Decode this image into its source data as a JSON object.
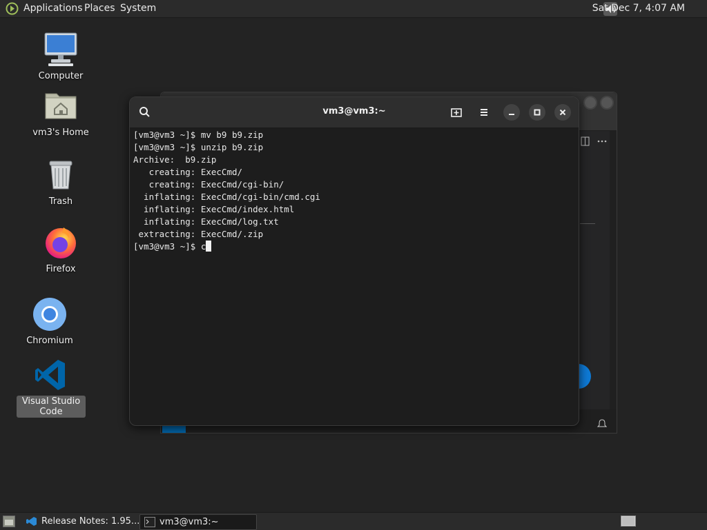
{
  "top_panel": {
    "menus": [
      "Applications",
      "Places",
      "System"
    ],
    "clock": "Sat Dec  7,  4:07 AM"
  },
  "desktop": {
    "icons": [
      {
        "label": "Computer"
      },
      {
        "label": "vm3's Home"
      },
      {
        "label": "Trash"
      },
      {
        "label": "Firefox"
      },
      {
        "label": "Chromium"
      },
      {
        "label": "Visual Studio Code",
        "selected": true
      }
    ]
  },
  "terminal": {
    "title": "vm3@vm3:~",
    "lines": [
      "[vm3@vm3 ~]$ mv b9 b9.zip",
      "[vm3@vm3 ~]$ unzip b9.zip",
      "Archive:  b9.zip",
      "   creating: ExecCmd/",
      "   creating: ExecCmd/cgi-bin/",
      "  inflating: ExecCmd/cgi-bin/cmd.cgi",
      "  inflating: ExecCmd/index.html",
      "  inflating: ExecCmd/log.txt",
      " extracting: ExecCmd/.zip"
    ],
    "prompt": "[vm3@vm3 ~]$ ",
    "input": "c"
  },
  "taskbar": {
    "tasks": [
      {
        "label": "Release Notes: 1.95...."
      },
      {
        "label": "vm3@vm3:~",
        "active": true
      }
    ]
  },
  "colors": {
    "panel_bg": "#2b2b2b",
    "desktop_bg": "#232323",
    "terminal_bg": "#1d1d1d",
    "firefox_orange": "#ff7139",
    "chromium_blue": "#4a90e2",
    "vscode_blue": "#0065a9"
  }
}
